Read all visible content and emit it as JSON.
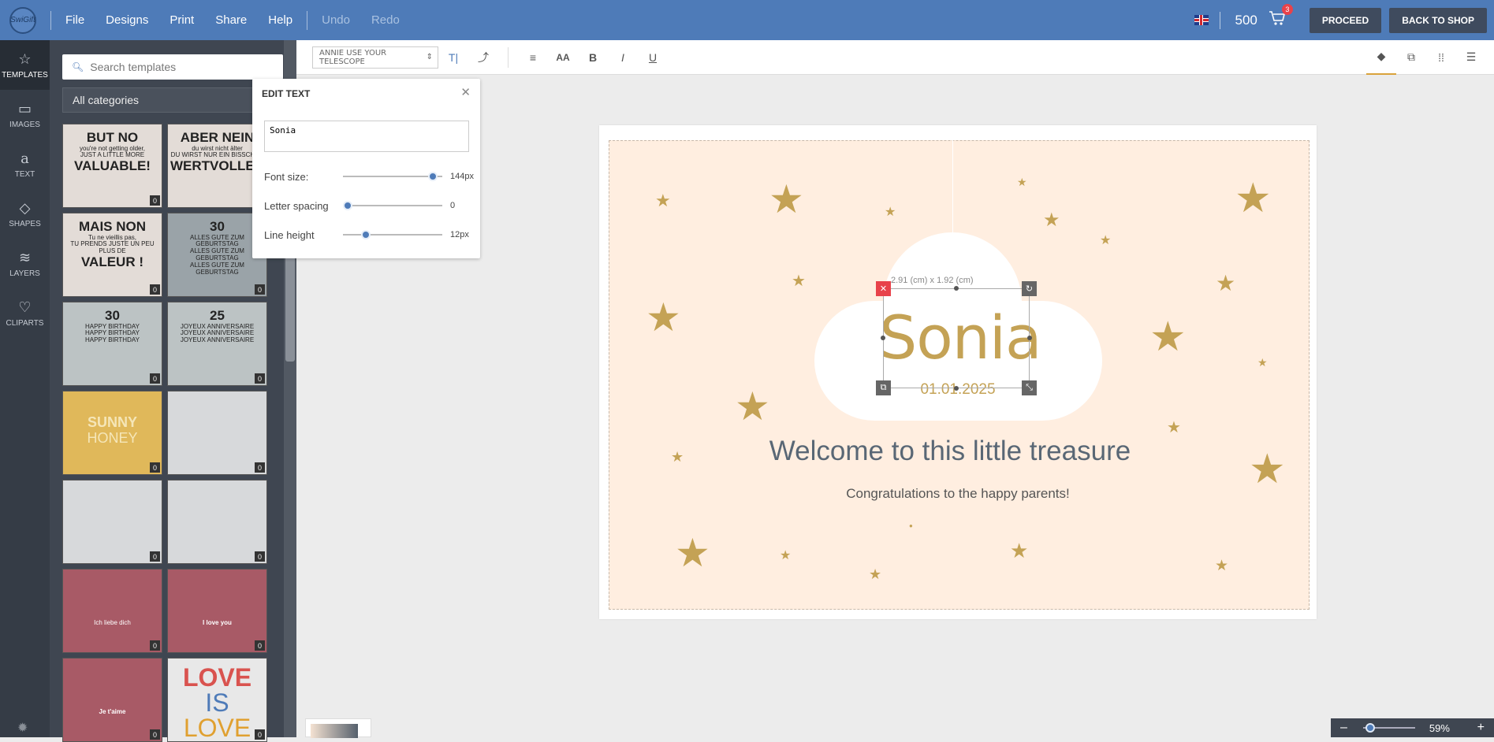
{
  "topbar": {
    "logo": "SwiGift",
    "menu": [
      "File",
      "Designs",
      "Print",
      "Share",
      "Help"
    ],
    "undo": "Undo",
    "redo": "Redo",
    "credits": "500",
    "cart_count": "3",
    "proceed": "PROCEED",
    "back": "BACK TO SHOP"
  },
  "rail": [
    {
      "label": "TEMPLATES",
      "icon": "star-icon"
    },
    {
      "label": "IMAGES",
      "icon": "image-icon"
    },
    {
      "label": "TEXT",
      "icon": "text-icon"
    },
    {
      "label": "SHAPES",
      "icon": "diamond-icon"
    },
    {
      "label": "LAYERS",
      "icon": "layers-icon"
    },
    {
      "label": "CLIPARTS",
      "icon": "heart-icon"
    }
  ],
  "panel": {
    "search_placeholder": "Search templates",
    "category": "All categories",
    "thumbs": [
      {
        "lines": [
          "BUT NO",
          "you're not getting older,",
          "JUST A LITTLE MORE",
          "VALUABLE!"
        ],
        "count": "0"
      },
      {
        "lines": [
          "ABER NEIN",
          "du wirst nicht älter",
          "DU WIRST NUR EIN BISSCHEN",
          "WERTVOLLER"
        ],
        "count": "0"
      },
      {
        "lines": [
          "MAIS NON",
          "Tu ne vieillis pas,",
          "TU PRENDS JUSTE UN PEU PLUS DE",
          "VALEUR !"
        ],
        "count": "0"
      },
      {
        "lines": [
          "30",
          "ALLES GUTE ZUM GEBURTSTAG",
          "ALLES GUTE ZUM GEBURTSTAG",
          "ALLES GUTE ZUM GEBURTSTAG"
        ],
        "count": "0"
      },
      {
        "lines": [
          "30",
          "HAPPY BIRTHDAY",
          "HAPPY BIRTHDAY",
          "HAPPY BIRTHDAY"
        ],
        "count": "0"
      },
      {
        "lines": [
          "25",
          "JOYEUX ANNIVERSAIRE",
          "JOYEUX ANNIVERSAIRE",
          "JOYEUX ANNIVERSAIRE"
        ],
        "count": "0"
      },
      {
        "lines": [
          "SUNNY",
          "HONEY",
          "",
          ""
        ],
        "count": "0"
      },
      {
        "lines": [
          "",
          "",
          "",
          ""
        ],
        "count": "0"
      },
      {
        "lines": [
          "",
          "",
          "",
          ""
        ],
        "count": "0"
      },
      {
        "lines": [
          "",
          "",
          "",
          ""
        ],
        "count": "0"
      },
      {
        "lines": [
          "",
          "",
          "",
          "Ich liebe dich"
        ],
        "count": "0"
      },
      {
        "lines": [
          "",
          "",
          "",
          "I love you"
        ],
        "count": "0"
      },
      {
        "lines": [
          "",
          "",
          "",
          "Je t'aime"
        ],
        "count": "0"
      },
      {
        "lines": [
          "LOVE",
          "IS",
          "LOVE",
          ""
        ],
        "count": "0"
      }
    ]
  },
  "toolbar": {
    "font": "ANNIE USE YOUR TELESCOPE"
  },
  "edit": {
    "title": "EDIT TEXT",
    "text": "Sonia",
    "font_size_label": "Font size:",
    "font_size_value": "144px",
    "font_size_level": 0.95,
    "letter_spacing_label": "Letter spacing",
    "letter_spacing_value": "0",
    "letter_spacing_level": 0.0,
    "line_height_label": "Line height",
    "line_height_value": "12px",
    "line_height_level": 0.2
  },
  "canvas": {
    "dimensions": "2.91 (cm) x 1.92 (cm)",
    "name": "Sonia",
    "date": "01.01.2025",
    "welcome": "Welcome to this little treasure",
    "congrats": "Congratulations to the happy parents!"
  },
  "zoom": {
    "value": "59%",
    "level": 0.05
  },
  "colors": {
    "accent": "#4e7bb8",
    "gold": "#c4a255",
    "card": "#ffeee0"
  }
}
